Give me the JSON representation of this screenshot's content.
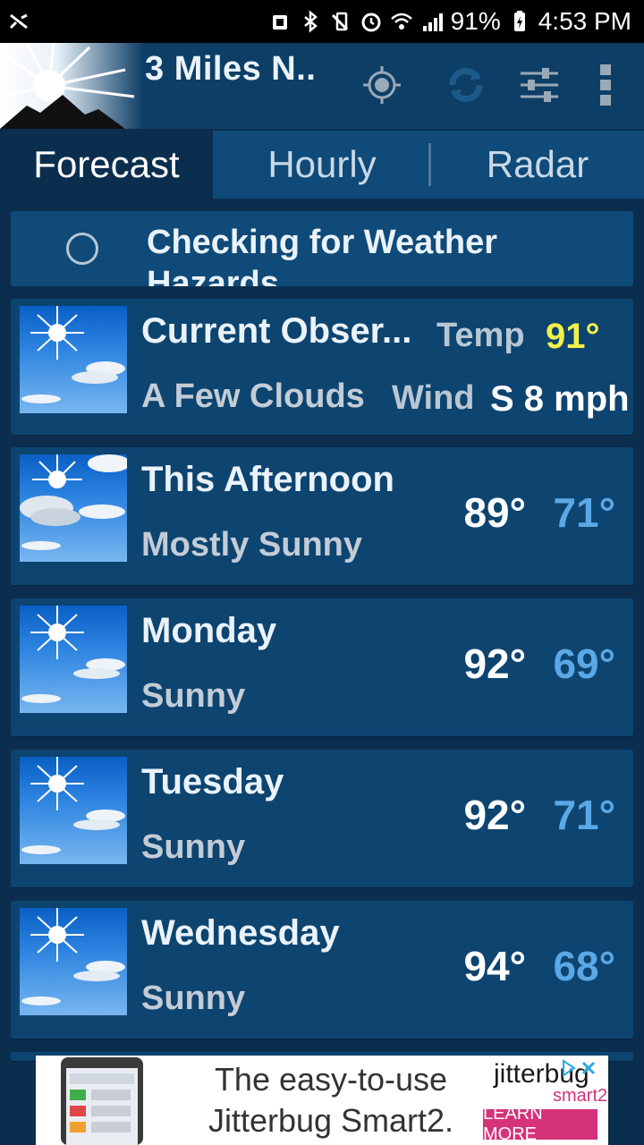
{
  "status_bar": {
    "battery": "91%",
    "time": "4:53 PM"
  },
  "app_bar": {
    "location": "3 Miles N.."
  },
  "tabs": [
    {
      "label": "Forecast",
      "active": true
    },
    {
      "label": "Hourly",
      "active": false
    },
    {
      "label": "Radar",
      "active": false
    }
  ],
  "hazard": {
    "text": "Checking for Weather Hazards"
  },
  "current": {
    "title": "Current Obser...",
    "condition": "A Few Clouds",
    "temp_label": "Temp",
    "temp_value": "91°",
    "wind_label": "Wind",
    "wind_value": "S 8 mph",
    "temp_color": "#f2f04a"
  },
  "forecast": [
    {
      "day": "This Afternoon",
      "condition": "Mostly Sunny",
      "high": "89°",
      "low": "71°"
    },
    {
      "day": "Monday",
      "condition": "Sunny",
      "high": "92°",
      "low": "69°"
    },
    {
      "day": "Tuesday",
      "condition": "Sunny",
      "high": "92°",
      "low": "71°"
    },
    {
      "day": "Wednesday",
      "condition": "Sunny",
      "high": "94°",
      "low": "68°"
    }
  ],
  "ad": {
    "headline_1": "The easy-to-use",
    "headline_2": "Jitterbug Smart2.",
    "brand": "jitterbug",
    "brand_sub": "smart2",
    "cta": "LEARN MORE",
    "accent": "#d4337a"
  },
  "icons": {
    "location": "locate-icon",
    "refresh": "refresh-icon",
    "settings": "sliders-icon",
    "menu": "overflow-menu-icon"
  }
}
